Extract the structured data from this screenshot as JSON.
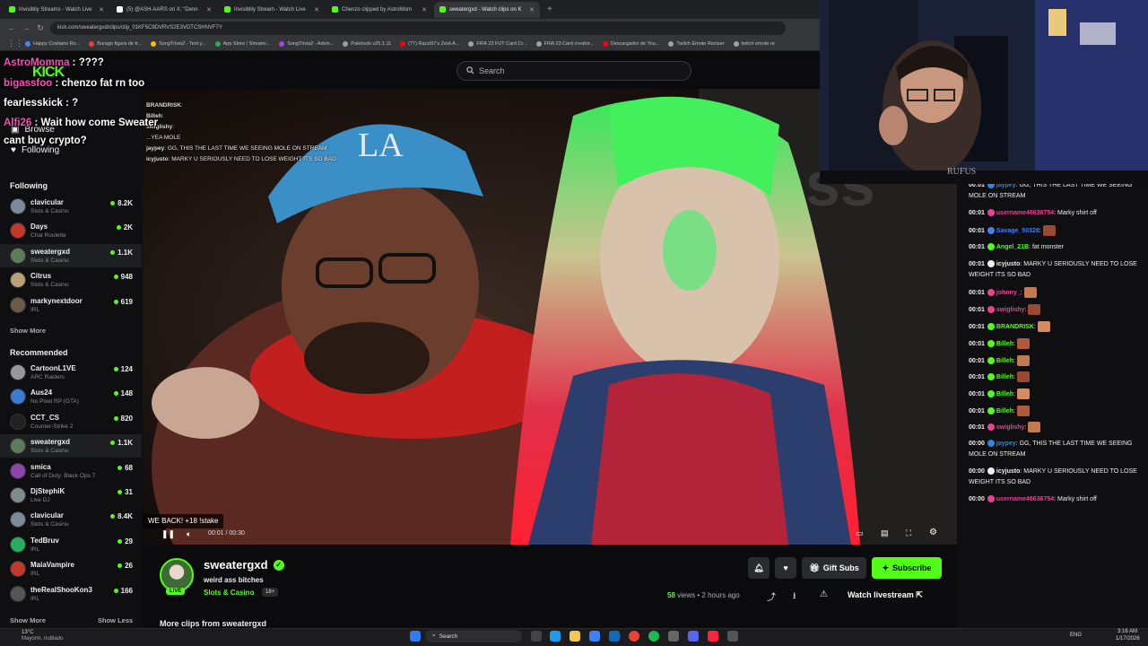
{
  "browser": {
    "tabs": [
      {
        "title": "Invisibliy Streams - Watch Live",
        "favicon_color": "#53fc18"
      },
      {
        "title": "(5) @ASH-AARS on X: \"Denn",
        "favicon_color": "#ffffff"
      },
      {
        "title": "Invisiblily Stream - Watch Live",
        "favicon_color": "#53fc18"
      },
      {
        "title": "Chenzo clipped by AstroMom",
        "favicon_color": "#53fc18"
      },
      {
        "title": "sweatergxd - Watch clips on K",
        "favicon_color": "#53fc18",
        "active": true
      }
    ],
    "url": "kick.com/sweatergxd/clips/clip_01KF5C9DVRVS2E3VDTCSHNVF7Y",
    "bookmarks": [
      {
        "label": "Happy Cristiano Ro...",
        "color": "#4285f4"
      },
      {
        "label": "Burago figura de tr...",
        "color": "#ea4335"
      },
      {
        "label": "SongTrivia2 - Test y...",
        "color": "#fbbc04"
      },
      {
        "label": "App Store / Streami...",
        "color": "#34a853"
      },
      {
        "label": "SongTrivia2 - Advin...",
        "color": "#a142f4"
      },
      {
        "label": "Paletools v25.1.11",
        "color": "#9aa0a6"
      },
      {
        "label": "(77) Razzi97's Zest-A...",
        "color": "#ff0000"
      },
      {
        "label": "FIFA 23 FUT Card Cr...",
        "color": "#9aa0a6"
      },
      {
        "label": "FIFA 23 Card creator...",
        "color": "#9aa0a6"
      },
      {
        "label": "Descargador de You...",
        "color": "#ff0000"
      },
      {
        "label": "Twitch Emote Resizer",
        "color": "#9aa0a6"
      },
      {
        "label": "twitch emote re",
        "color": "#9aa0a6"
      }
    ]
  },
  "header": {
    "logo": "KICK",
    "search_placeholder": "Search"
  },
  "sidebar": {
    "browse": "Browse",
    "following": "Following",
    "following_title": "Following",
    "following_channels": [
      {
        "name": "clavicular",
        "category": "Slots & Casino",
        "viewers": "8.2K",
        "color": "#7a8a9a"
      },
      {
        "name": "Days",
        "category": "Chat Roulette",
        "viewers": "2K",
        "color": "#c0392b"
      },
      {
        "name": "sweatergxd",
        "category": "Slots & Casino",
        "viewers": "1.1K",
        "color": "#5d7d5a",
        "highlight": true
      },
      {
        "name": "Citrus",
        "category": "Slots & Casino",
        "viewers": "948",
        "color": "#b9a27a"
      },
      {
        "name": "markynextdoor",
        "category": "IRL",
        "viewers": "619",
        "color": "#6b5b4b"
      }
    ],
    "show_more": "Show More",
    "recommended_title": "Recommended",
    "recommended_channels": [
      {
        "name": "CartoonL1VE",
        "category": "ARC Raiders",
        "viewers": "124",
        "color": "#999999"
      },
      {
        "name": "Aus24",
        "category": "No Pixel RP (GTA)",
        "viewers": "148",
        "color": "#3a7bd5"
      },
      {
        "name": "CCT_CS",
        "category": "Counter-Strike 2",
        "viewers": "820",
        "color": "#222222"
      },
      {
        "name": "sweatergxd",
        "category": "Slots & Casino",
        "viewers": "1.1K",
        "color": "#5d7d5a",
        "highlight": true
      },
      {
        "name": "smica",
        "category": "Call of Duty: Black Ops 7",
        "viewers": "68",
        "color": "#8e44ad"
      },
      {
        "name": "DjStephiK",
        "category": "Live DJ",
        "viewers": "31",
        "color": "#7f8c8d"
      },
      {
        "name": "clavicular",
        "category": "Slots & Casino",
        "viewers": "8.4K",
        "color": "#7a8a9a"
      },
      {
        "name": "TedBruv",
        "category": "IRL",
        "viewers": "29",
        "color": "#27ae60"
      },
      {
        "name": "MaiaVampire",
        "category": "IRL",
        "viewers": "26",
        "color": "#c0392b"
      },
      {
        "name": "theRealShooKon3",
        "category": "IRL",
        "viewers": "166",
        "color": "#555555"
      }
    ],
    "show_more_2": "Show More",
    "show_less": "Show Less"
  },
  "player": {
    "clip_overlay_title": "WE BACK! +18 !stake",
    "time": "00:01 / 00:30",
    "inner_chat": [
      {
        "user": "BRANDRISK",
        "text": ""
      },
      {
        "user": "Billeh",
        "text": ""
      },
      {
        "user": "swiglishy",
        "text": ""
      },
      {
        "user": "",
        "text": "...YEA MOLE"
      },
      {
        "user": "jaypey",
        "text": "GG, THIS THE LAST TIME WE SEEING MOLE ON STREAM"
      },
      {
        "user": "icyjusto",
        "text": "MARKY U SERIOUSLY NEED TO LOSE WEIGHT ITS SO BAD"
      }
    ]
  },
  "clip_info": {
    "streamer": "sweatergxd",
    "title": "weird ass bitches",
    "category": "Slots & Casino",
    "age_rating": "18+",
    "live_badge": "LIVE",
    "views": "58",
    "views_label": "views",
    "time_ago": "• 2 hours ago",
    "gift_subs": "Gift Subs",
    "subscribe": "Subscribe",
    "watch_livestream": "Watch livestream",
    "more_clips": "More clips from sweatergxd"
  },
  "chat": {
    "messages": [
      {
        "time": "00:01",
        "user": "jaypey",
        "color": "#2e86de",
        "text": "GG, THIS THE LAST TIME WE SEEING MOLE ON STREAM"
      },
      {
        "time": "00:01",
        "user": "username46636754",
        "color": "#e84393",
        "text": "Marky shirt off"
      },
      {
        "time": "00:01",
        "user": "Savage_50328",
        "color": "#4b7bec",
        "text": ""
      },
      {
        "time": "00:01",
        "user": "Angel_21B",
        "color": "#53fc18",
        "text": "fat monster"
      },
      {
        "time": "00:01",
        "user": "icyjusto",
        "color": "#efeff1",
        "text": "MARKY U SERIOUSLY NEED TO LOSE WEIGHT ITS SO BAD"
      },
      {
        "time": "00:01",
        "user": "johnny_",
        "color": "#e84393",
        "text": ""
      },
      {
        "time": "00:01",
        "user": "swiglishy",
        "color": "#e84393",
        "text": ""
      },
      {
        "time": "00:01",
        "user": "BRANDRISK",
        "color": "#53fc18",
        "text": ""
      },
      {
        "time": "00:01",
        "user": "Billeh",
        "color": "#53fc18",
        "text": ""
      },
      {
        "time": "00:01",
        "user": "Billeh",
        "color": "#53fc18",
        "text": ""
      },
      {
        "time": "00:01",
        "user": "Billeh",
        "color": "#53fc18",
        "text": ""
      },
      {
        "time": "00:01",
        "user": "Billeh",
        "color": "#53fc18",
        "text": ""
      },
      {
        "time": "00:01",
        "user": "Billeh",
        "color": "#53fc18",
        "text": ""
      },
      {
        "time": "00:01",
        "user": "swiglishy",
        "color": "#e84393",
        "text": ""
      },
      {
        "time": "00:00",
        "user": "jaypey",
        "color": "#2e86de",
        "text": "GG, THIS THE LAST TIME WE SEEING MOLE ON STREAM"
      },
      {
        "time": "00:00",
        "user": "icyjusto",
        "color": "#efeff1",
        "text": "MARKY U SERIOUSLY NEED TO LOSE WEIGHT ITS SO BAD"
      },
      {
        "time": "00:00",
        "user": "username46636754",
        "color": "#e84393",
        "text": "Marky shirt off"
      }
    ]
  },
  "stream_overlay_chat": [
    {
      "user": "AstroMomma",
      "user_color": "#ff4db8",
      "text": " : ????"
    },
    {
      "user": "bigassfoo",
      "user_color": "#ff4db8",
      "text": " : chenzo fat rn too"
    },
    {
      "user": "fearlesskick",
      "user_color": "#ffffff",
      "text": " : ?"
    },
    {
      "user": "Alfi26",
      "user_color": "#ff4db8",
      "text": " : Wait how come Sweater"
    },
    {
      "user": "",
      "user_color": "#ffffff",
      "text": "cant buy crypto?"
    }
  ],
  "webcam": {
    "watermark": "RUFUS"
  },
  "taskbar": {
    "weather_temp": "13°C",
    "weather_text": "Mayorm. nublado",
    "search": "Search",
    "lang": "ENG",
    "time": "3:16 AM",
    "date": "1/17/2026"
  }
}
